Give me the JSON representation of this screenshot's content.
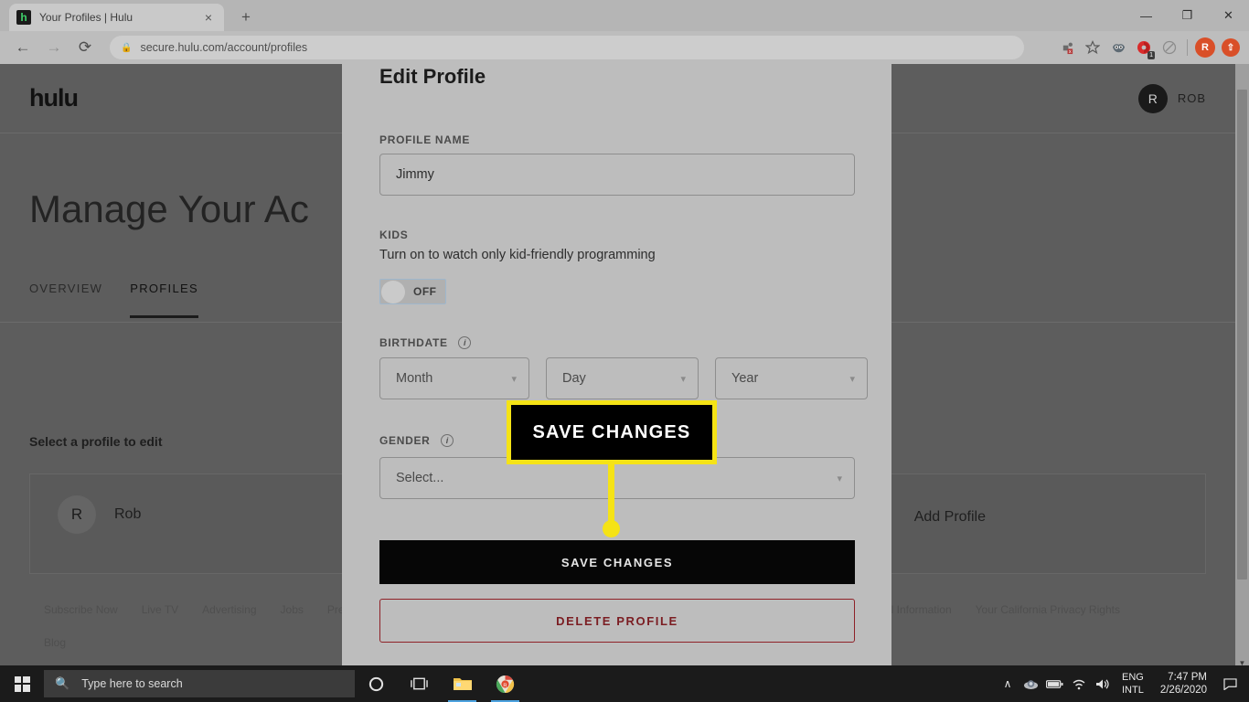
{
  "browser": {
    "tab": {
      "title": "Your Profiles | Hulu",
      "favicon": "hulu-favicon",
      "favicon_letter": "h",
      "close": "×"
    },
    "new_tab_label": "+",
    "window_controls": {
      "minimize": "—",
      "maximize": "❐",
      "close": "✕"
    },
    "nav": {
      "back": "←",
      "forward": "→",
      "reload": "⟳"
    },
    "address": {
      "lock_icon": "lock-icon",
      "domain": "secure.hulu.com",
      "path": "/account/profiles",
      "full": "secure.hulu.com/account/profiles"
    },
    "toolbar_icons": [
      {
        "name": "extension-blocked-icon",
        "glyph": "⌨",
        "badge": ""
      },
      {
        "name": "bookmark-star-icon",
        "glyph": "☆",
        "badge": ""
      },
      {
        "name": "extension-owl-icon",
        "glyph": "◔",
        "badge": ""
      },
      {
        "name": "extension-counter-icon",
        "glyph": "◕",
        "badge": "1"
      },
      {
        "name": "extension-disabled-icon",
        "glyph": "⊘",
        "badge": ""
      }
    ],
    "profile_avatar_letter": "R",
    "update_avatar_letter": "⬆"
  },
  "page": {
    "brand": "hulu",
    "user": {
      "initial": "R",
      "name": "ROB"
    },
    "title": "Manage Your Ac",
    "tabs": [
      {
        "label": "OVERVIEW",
        "active": false
      },
      {
        "label": "PROFILES",
        "active": true
      }
    ],
    "select_profile_label": "Select a profile to edit",
    "profiles": [
      {
        "initial": "R",
        "name": "Rob"
      }
    ],
    "add_profile_label": "Add Profile",
    "footer_links_row1": [
      "Subscribe Now",
      "Live TV",
      "Advertising",
      "Jobs",
      "Press",
      "onal Information",
      "Your California Privacy Rights"
    ],
    "footer_links_row2": [
      "Blog"
    ]
  },
  "modal": {
    "title": "Edit Profile",
    "profile_name": {
      "label": "PROFILE NAME",
      "value": "Jimmy",
      "placeholder": "Profile Name"
    },
    "kids": {
      "label": "KIDS",
      "description": "Turn on to watch only kid-friendly programming",
      "toggle_state": "OFF"
    },
    "birthdate": {
      "label": "BIRTHDATE",
      "info_icon": "info-icon",
      "month": {
        "value": "Month",
        "caret": "⌄"
      },
      "day": {
        "value": "Day",
        "caret": "⌄"
      },
      "year": {
        "value": "Year",
        "caret": "⌄"
      }
    },
    "gender": {
      "label": "GENDER",
      "info_icon": "info-icon",
      "value": "Select...",
      "caret": "⌄"
    },
    "save_button": "SAVE CHANGES",
    "delete_button": "DELETE PROFILE"
  },
  "callout": {
    "text": "SAVE CHANGES",
    "border_color": "#f5e316",
    "background_color": "#000000"
  },
  "taskbar": {
    "start_icon": "windows-start-icon",
    "search_placeholder": "Type here to search",
    "search_icon": "search-icon",
    "apps": [
      {
        "name": "cortana-icon",
        "glyph": "◯"
      },
      {
        "name": "task-view-icon",
        "glyph": "⧉"
      },
      {
        "name": "file-explorer-icon",
        "glyph": "🗀"
      },
      {
        "name": "chrome-icon",
        "glyph": "●"
      }
    ],
    "tray": {
      "chevron": "∧",
      "icons": [
        {
          "name": "onedrive-icon",
          "glyph": "☁"
        },
        {
          "name": "battery-icon",
          "glyph": "▭"
        },
        {
          "name": "wifi-icon",
          "glyph": "◠"
        },
        {
          "name": "volume-icon",
          "glyph": "🔊"
        }
      ],
      "language_line1": "ENG",
      "language_line2": "INTL",
      "time": "7:47 PM",
      "date": "2/26/2020",
      "notifications_icon": "notification-icon",
      "notifications_glyph": "▭"
    }
  },
  "colors": {
    "accent_yellow": "#f5e316",
    "delete_red": "#8e2127",
    "modal_bg": "#bdbdbd",
    "page_dim": "#5d5d5d"
  }
}
